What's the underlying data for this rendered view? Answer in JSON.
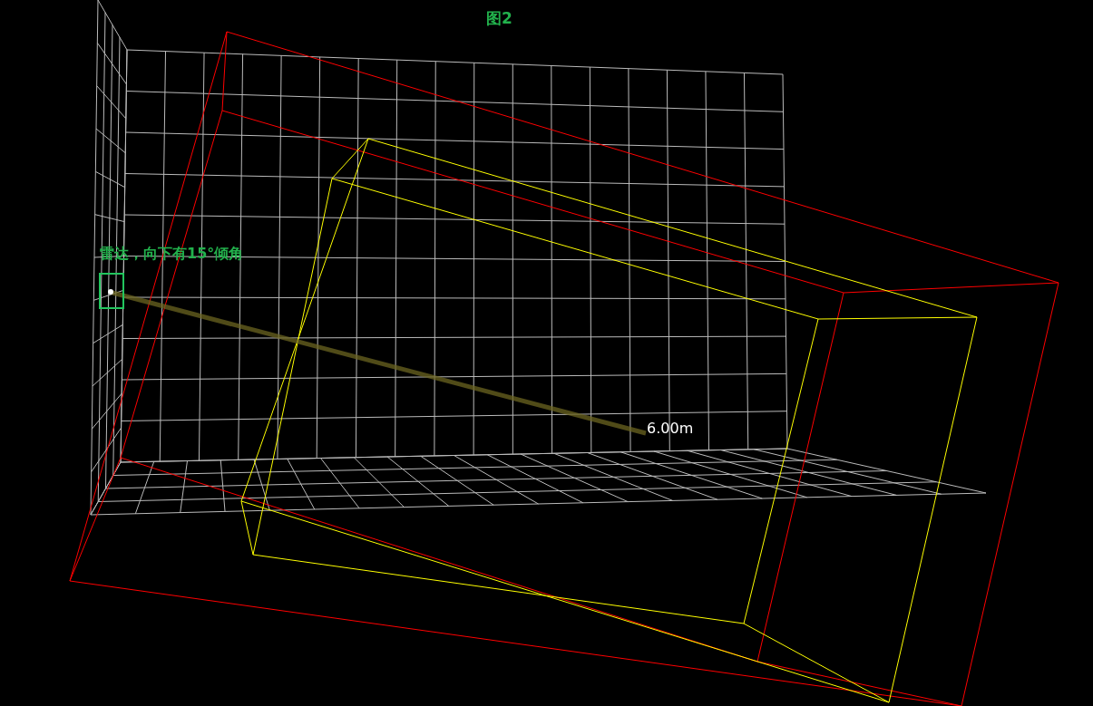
{
  "figure": {
    "title": "图2"
  },
  "radar": {
    "label": "雷达，向下有15°倾角"
  },
  "beam": {
    "distance_label": "6.00m"
  }
}
